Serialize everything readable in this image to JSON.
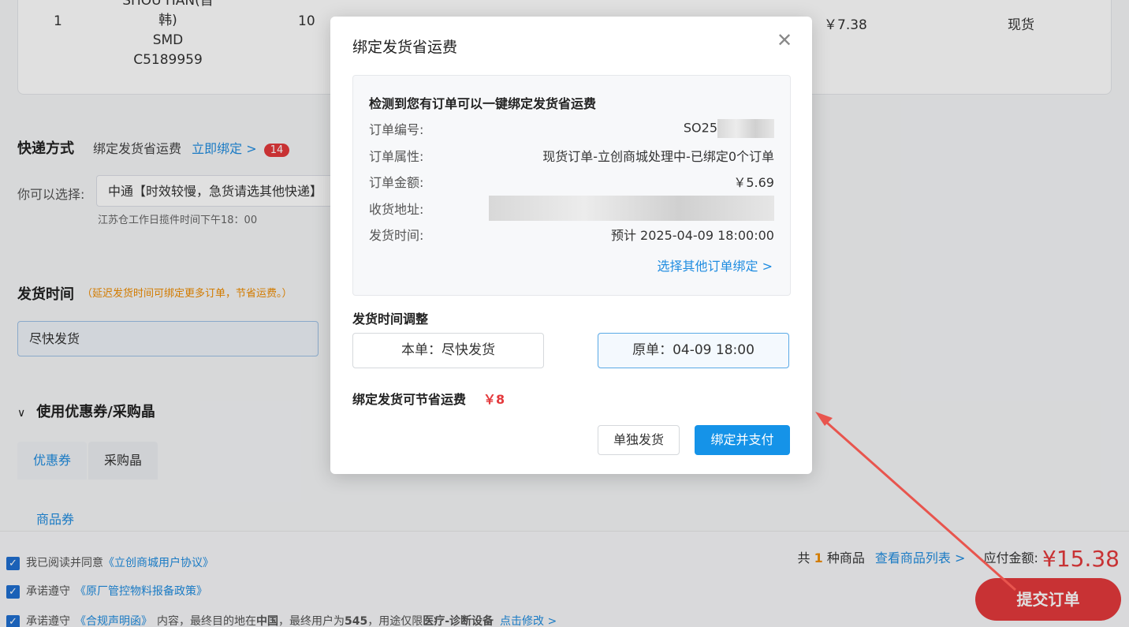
{
  "order_row": {
    "index": "1",
    "name_lines": [
      "SHOU HAN(首",
      "韩)",
      "SMD",
      "C5189959"
    ],
    "qty": "10",
    "price": "￥7.38",
    "stock": "现货"
  },
  "express": {
    "title": "快递方式",
    "bind_text": "绑定发货省运费",
    "bind_link": "立即绑定 >",
    "badge": "14",
    "choose_label": "你可以选择:",
    "selected": "中通【时效较慢，急货请选其他快递】",
    "cutoff": "江苏仓工作日揽件时间下午18：00"
  },
  "ship_time": {
    "title": "发货时间",
    "hint": "（延迟发货时间可绑定更多订单，节省运费。）",
    "value": "尽快发货"
  },
  "coupon": {
    "title": "使用优惠券/采购晶",
    "tabs": [
      "优惠券",
      "采购晶"
    ],
    "sub": "商品券"
  },
  "footer": {
    "agree1_prefix": "我已阅读并同意",
    "agree1_link": "《立创商城用户协议》",
    "agree2_prefix": "承诺遵守",
    "agree2_link": "《原厂管控物料报备政策》",
    "agree3_prefix": "承诺遵守",
    "agree3_link": "《合规声明函》",
    "agree3_text1": "内容，最终目的地在",
    "agree3_dest": "中国",
    "agree3_text2": "，最终用户为",
    "agree3_user": "545",
    "agree3_text3": "，用途仅限",
    "agree3_use": "医疗-诊断设备",
    "agree3_edit": "点击修改 >",
    "count_prefix": "共",
    "count": "1",
    "count_suffix": "种商品",
    "view_list": "查看商品列表 >",
    "pay_label": "应付金额:",
    "pay_amount": "¥15.38",
    "submit": "提交订单"
  },
  "modal": {
    "title": "绑定发货省运费",
    "heading": "检测到您有订单可以一键绑定发货省运费",
    "rows": [
      {
        "label": "订单编号:",
        "value": "SO25"
      },
      {
        "label": "订单属性:",
        "value": "现货订单-立创商城处理中-已绑定0个订单"
      },
      {
        "label": "订单金额:",
        "value": "￥5.69"
      },
      {
        "label": "收货地址:",
        "value": ""
      },
      {
        "label": "发货时间:",
        "value": "预计 2025-04-09 18:00:00"
      }
    ],
    "other_link": "选择其他订单绑定 >",
    "adjust_title": "发货时间调整",
    "opt_this": "本单：尽快发货",
    "opt_orig": "原单：04-09 18:00",
    "save_label": "绑定发货可节省运费",
    "save_amount": "￥8",
    "btn_separate": "单独发货",
    "btn_bind_pay": "绑定并支付"
  },
  "colors": {
    "accent": "#1593e8",
    "danger": "#e4393c",
    "link": "#1f8ce0"
  }
}
